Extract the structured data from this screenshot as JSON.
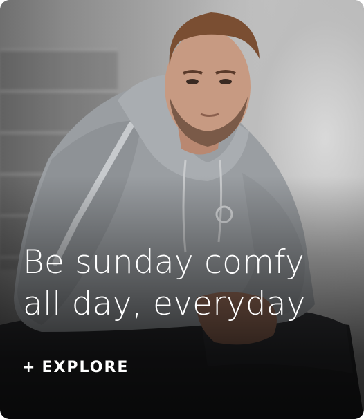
{
  "promo": {
    "headline_line1": "Be sunday comfy",
    "headline_line2": "all day, everyday",
    "cta_icon": "+",
    "cta_label": "EXPLORE"
  },
  "colors": {
    "text": "#ffffff",
    "hoodie": "#9a9ea2",
    "background": "#b5b5b5"
  },
  "icons": {
    "cta": "plus-icon"
  }
}
